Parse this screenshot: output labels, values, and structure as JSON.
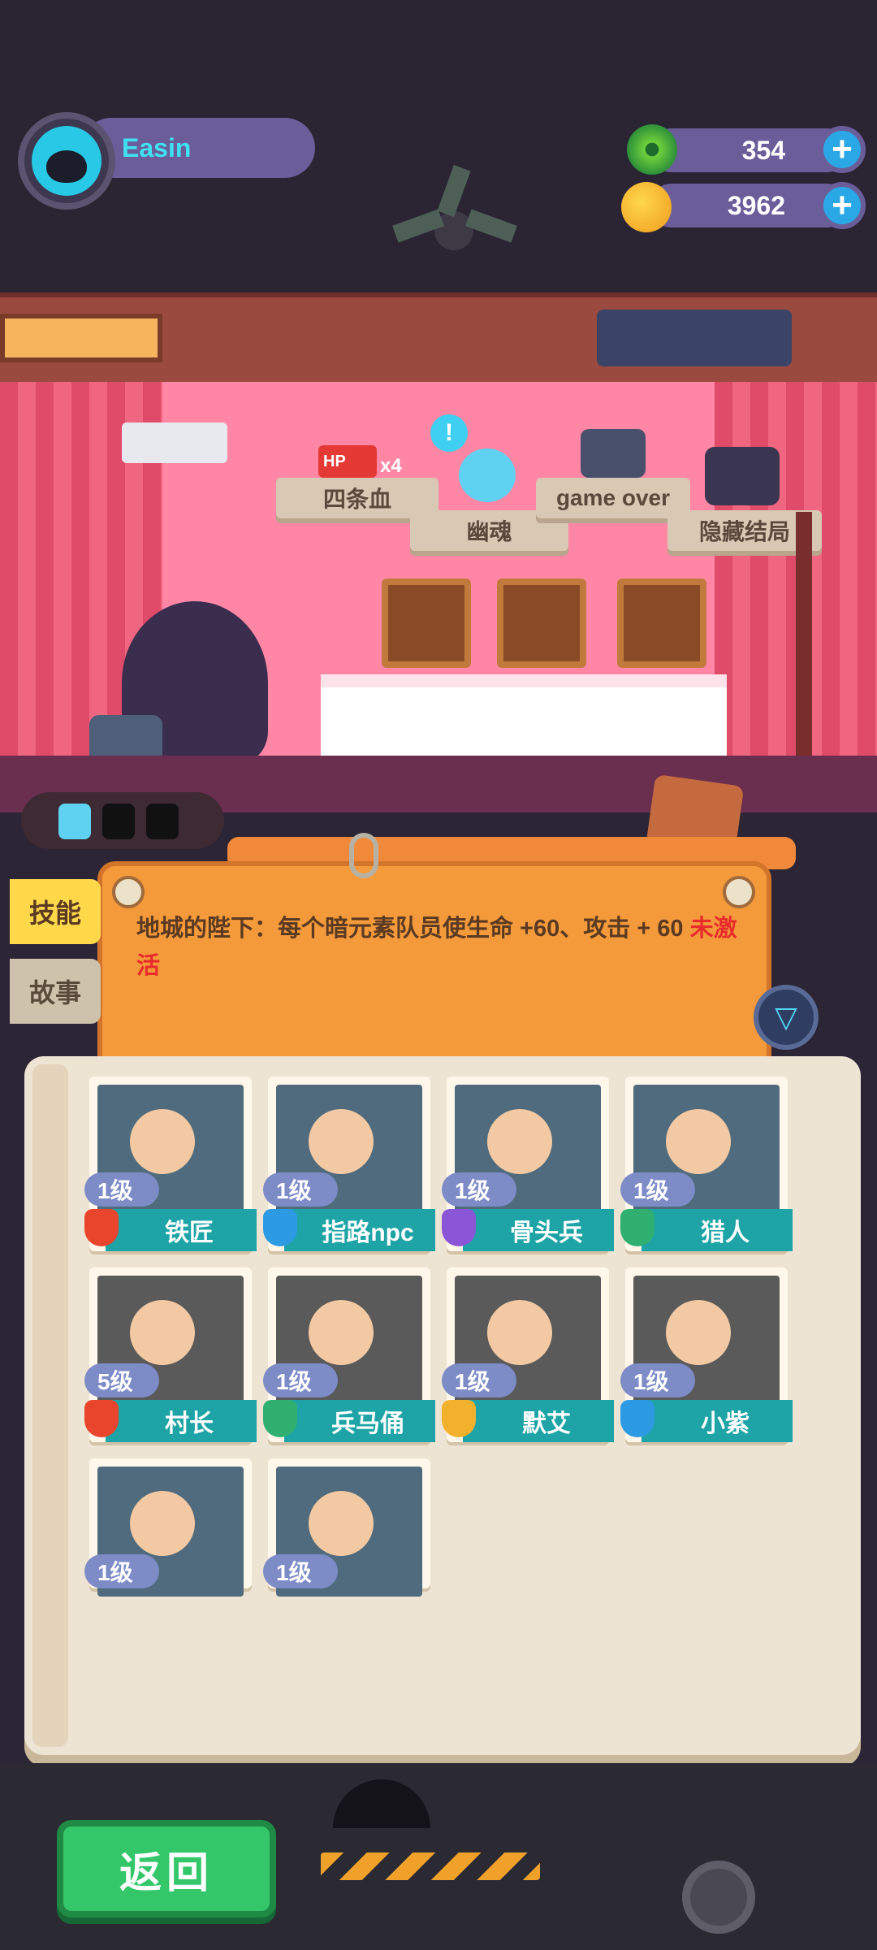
{
  "player": {
    "name": "Easin"
  },
  "currency": {
    "gems": {
      "value": "354",
      "icon": "green-donut-coin-icon"
    },
    "coins": {
      "value": "3962",
      "icon": "planet-coin-icon"
    }
  },
  "room": {
    "signs": [
      {
        "label": "四条血",
        "badge": "x4",
        "hp": "HP"
      },
      {
        "label": "幽魂"
      },
      {
        "label": "game over"
      },
      {
        "label": "隐藏结局"
      }
    ]
  },
  "tabs": [
    {
      "label": "技能",
      "active": true
    },
    {
      "label": "故事",
      "active": false
    }
  ],
  "skill": {
    "text": "地城的陛下：每个暗元素队员使生命 +60、攻击 + 60",
    "status": "未激活"
  },
  "characters": [
    {
      "level": "1级",
      "name": "铁匠",
      "element": "#e8452c",
      "bg": "#4f6b7d"
    },
    {
      "level": "1级",
      "name": "指路npc",
      "element": "#2d9be3",
      "bg": "#4f6b7d"
    },
    {
      "level": "1级",
      "name": "骨头兵",
      "element": "#8a55d6",
      "bg": "#4f6b7d"
    },
    {
      "level": "1级",
      "name": "猎人",
      "element": "#2fb070",
      "bg": "#4f6b7d"
    },
    {
      "level": "5级",
      "name": "村长",
      "element": "#e8452c",
      "bg": "#5a5a5a"
    },
    {
      "level": "1级",
      "name": "兵马俑",
      "element": "#2fb070",
      "bg": "#5a5a5a"
    },
    {
      "level": "1级",
      "name": "默艾",
      "element": "#f2b12d",
      "bg": "#5a5a5a"
    },
    {
      "level": "1级",
      "name": "小紫",
      "element": "#2d9be3",
      "bg": "#5a5a5a"
    },
    {
      "level": "1级",
      "name": "",
      "element": "#e8452c",
      "bg": "#4f6b7d"
    },
    {
      "level": "1级",
      "name": "",
      "element": "#e8452c",
      "bg": "#4f6b7d"
    }
  ],
  "buttons": {
    "back": "返回"
  },
  "colors": {
    "accent": "#1ea4a6",
    "panel": "#f59a3a",
    "back": "#34c76a"
  }
}
